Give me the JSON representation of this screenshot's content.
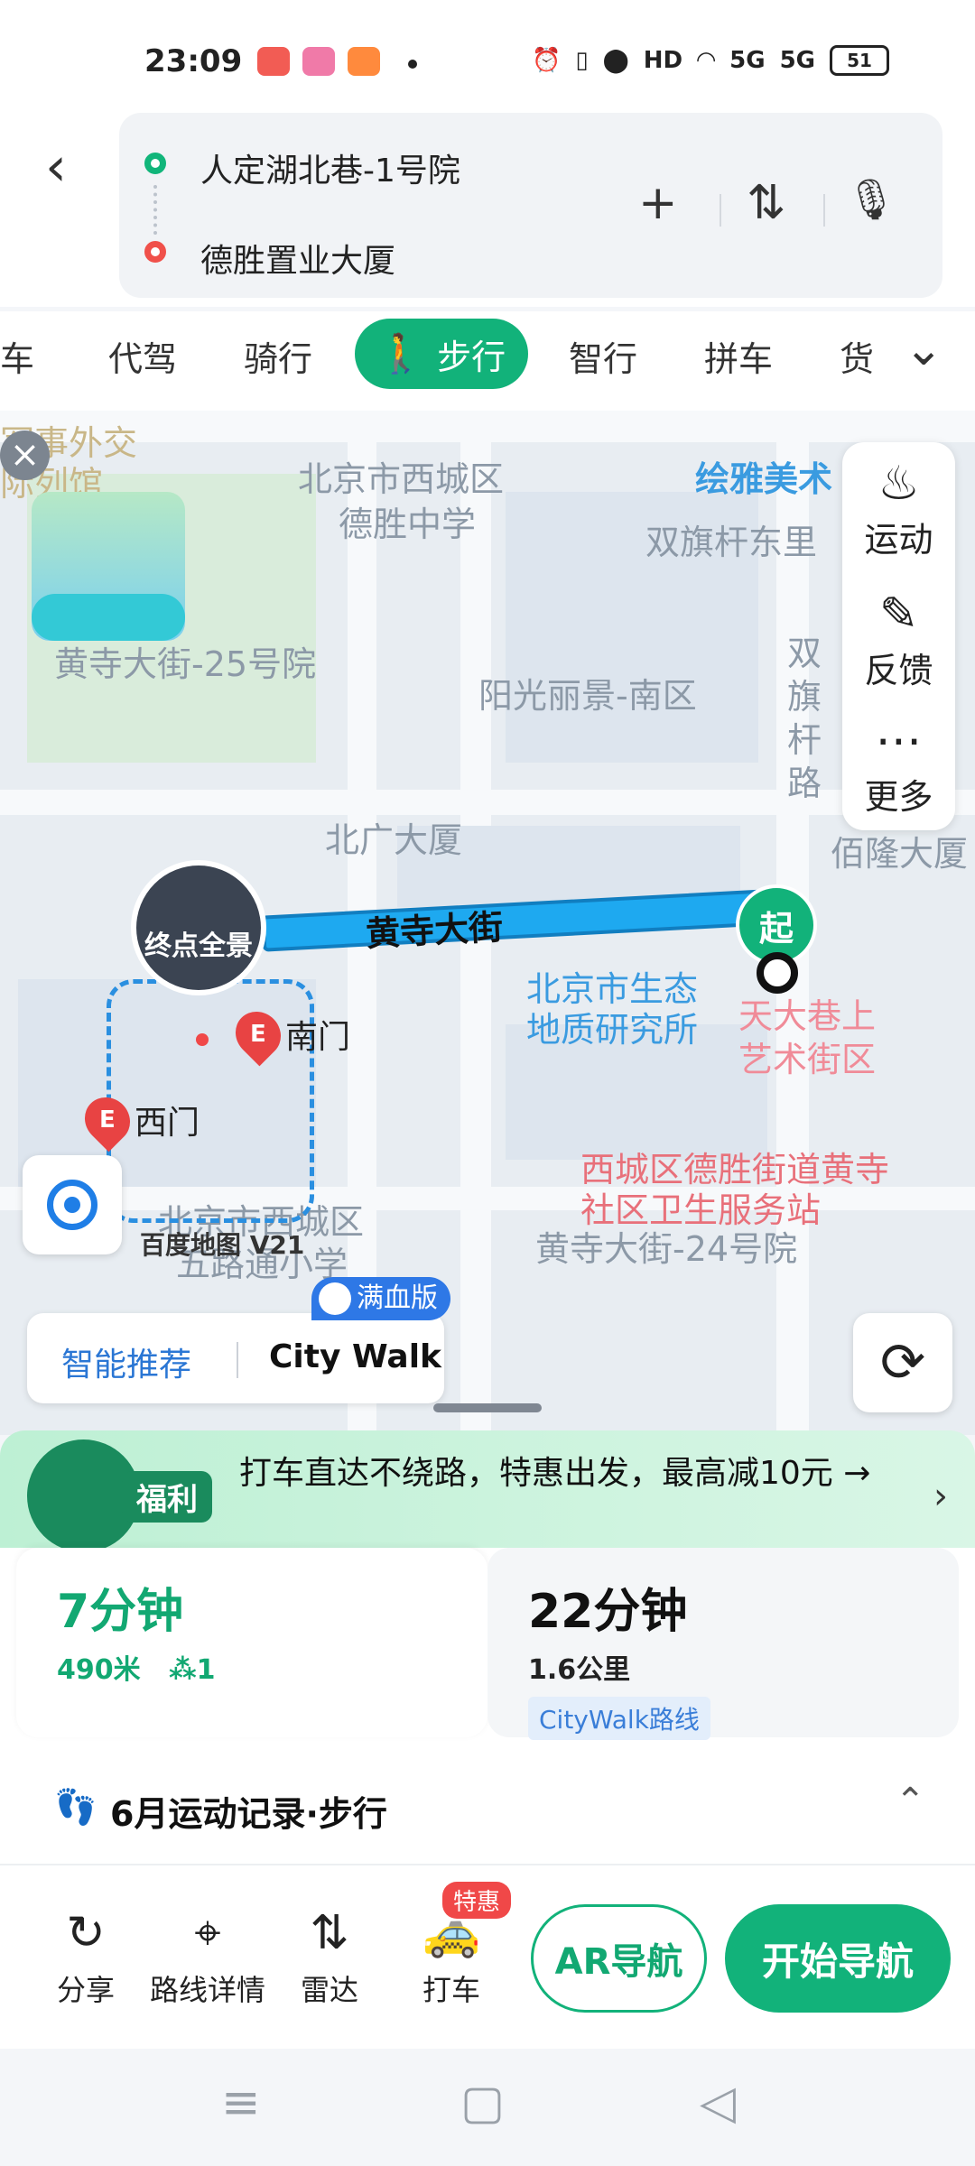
{
  "status_bar": {
    "time": "23:09",
    "network_1": "5G",
    "network_2": "5G",
    "hd": "HD",
    "battery": "51"
  },
  "route": {
    "start": "人定湖北巷-1号院",
    "end": "德胜置业大厦",
    "add_icon": "+",
    "swap_icon": "⇅",
    "mic_icon": "🎙"
  },
  "modes": {
    "items": [
      "车",
      "代驾",
      "骑行",
      "步行",
      "智行",
      "拼车",
      "货"
    ],
    "active": "步行"
  },
  "map": {
    "labels": {
      "military": "军事外交",
      "museum": "际列馆",
      "district": "北京市西城区",
      "school": "德胜中学",
      "art": "绘雅美术",
      "dongli": "双旗杆东里",
      "yard25": "黄寺大街-25号院",
      "sunshine": "阳光丽景-南区",
      "shuangqi": "双旗杆路",
      "beiguang": "北广大厦",
      "peilong": "佰隆大厦",
      "road": "黄寺大街",
      "geo_1": "北京市生态",
      "geo_2": "地质研究所",
      "art_street_1": "天大巷上",
      "art_street_2": "艺术街区",
      "district2": "北京市西城区",
      "school2": "五路通小学",
      "health_1": "西城区德胜街道黄寺",
      "health_2": "社区卫生服务站",
      "yard24": "黄寺大街-24号院"
    },
    "end_photo_label": "终点全景",
    "start_marker": "起",
    "gate_south": "南门",
    "gate_west": "西门",
    "scale_text": "百度地图 V21",
    "side_panel": {
      "sport": "运动",
      "feedback": "反馈",
      "more": "更多"
    },
    "smart_recommend": "智能推荐",
    "city_walk": "City Walk",
    "full_badge": "满血版"
  },
  "promo": {
    "badge": "福利",
    "text": "打车直达不绕路，特惠出发，最高减10元 →"
  },
  "options": [
    {
      "duration": "7分钟",
      "distance": "490米",
      "lights": "1"
    },
    {
      "duration": "22分钟",
      "distance": "1.6公里",
      "tag": "CityWalk路线"
    }
  ],
  "record": {
    "title": "6月运动记录·步行"
  },
  "actions": {
    "share": "分享",
    "details": "路线详情",
    "radar": "雷达",
    "taxi": "打车",
    "taxi_badge": "特惠",
    "ar_nav": "AR导航",
    "start_nav": "开始导航"
  }
}
